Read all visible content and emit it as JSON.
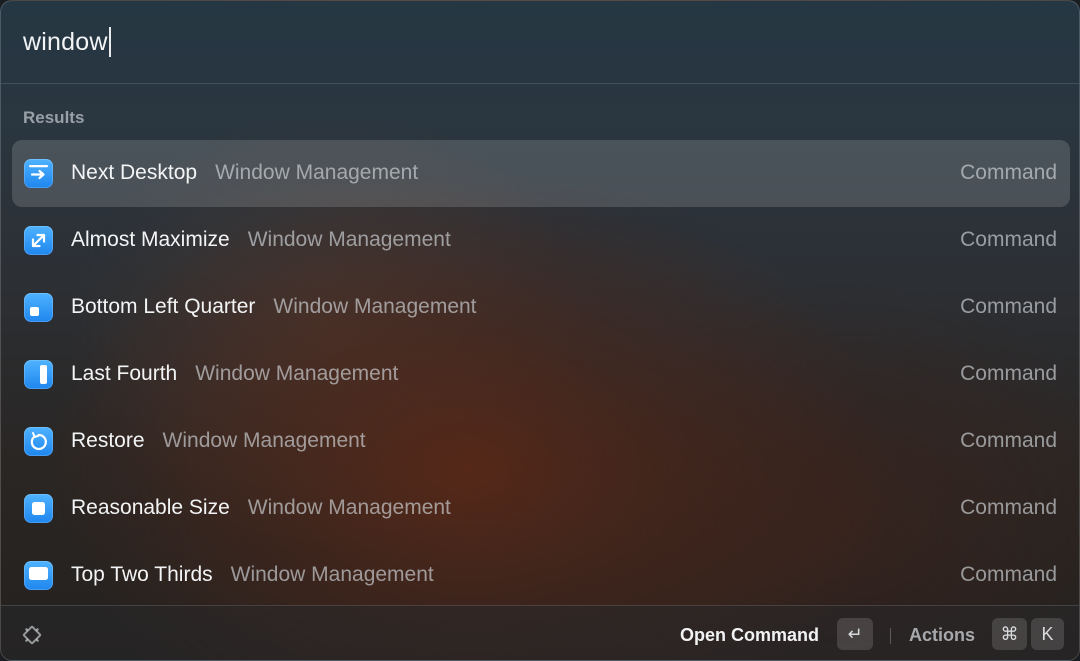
{
  "search": {
    "value": "window"
  },
  "section": {
    "title": "Results"
  },
  "results": [
    {
      "title": "Next Desktop",
      "subtitle": "Window Management",
      "kind": "Command",
      "icon": "next-desktop-icon",
      "selected": true
    },
    {
      "title": "Almost Maximize",
      "subtitle": "Window Management",
      "kind": "Command",
      "icon": "almost-maximize-icon",
      "selected": false
    },
    {
      "title": "Bottom Left Quarter",
      "subtitle": "Window Management",
      "kind": "Command",
      "icon": "bottom-left-quarter-icon",
      "selected": false
    },
    {
      "title": "Last Fourth",
      "subtitle": "Window Management",
      "kind": "Command",
      "icon": "last-fourth-icon",
      "selected": false
    },
    {
      "title": "Restore",
      "subtitle": "Window Management",
      "kind": "Command",
      "icon": "restore-icon",
      "selected": false
    },
    {
      "title": "Reasonable Size",
      "subtitle": "Window Management",
      "kind": "Command",
      "icon": "reasonable-size-icon",
      "selected": false
    },
    {
      "title": "Top Two Thirds",
      "subtitle": "Window Management",
      "kind": "Command",
      "icon": "top-two-thirds-icon",
      "selected": false
    }
  ],
  "footer": {
    "primary_action": "Open Command",
    "enter_key": "↵",
    "actions_label": "Actions",
    "cmd_key": "⌘",
    "k_key": "K"
  },
  "colors": {
    "accent_icon": "#2f9cf8",
    "selected_row": "rgba(255,255,255,0.15)"
  }
}
